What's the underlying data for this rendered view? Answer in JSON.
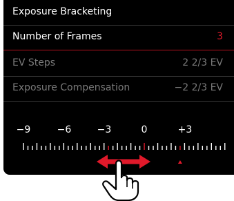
{
  "menu": {
    "title": "Exposure Bracketing",
    "items": [
      {
        "label": "Number of Frames",
        "value": "3",
        "active": true
      },
      {
        "label": "EV Steps",
        "value": "2 2/3 EV",
        "active": false
      },
      {
        "label": "Exposure Compensation",
        "value": "−2 2/3 EV",
        "active": false
      }
    ]
  },
  "scale": {
    "labels": [
      "−9",
      "−6",
      "−3",
      "0",
      "+3"
    ],
    "bracket_markers_ev": [
      -2.667,
      0,
      2.667
    ]
  },
  "colors": {
    "accent": "#e0192a",
    "background": "#000000",
    "dim_text": "#7a7a7a"
  },
  "gesture": {
    "icon": "swipe-hand-icon",
    "arrows": "left-right-arrows-icon"
  }
}
